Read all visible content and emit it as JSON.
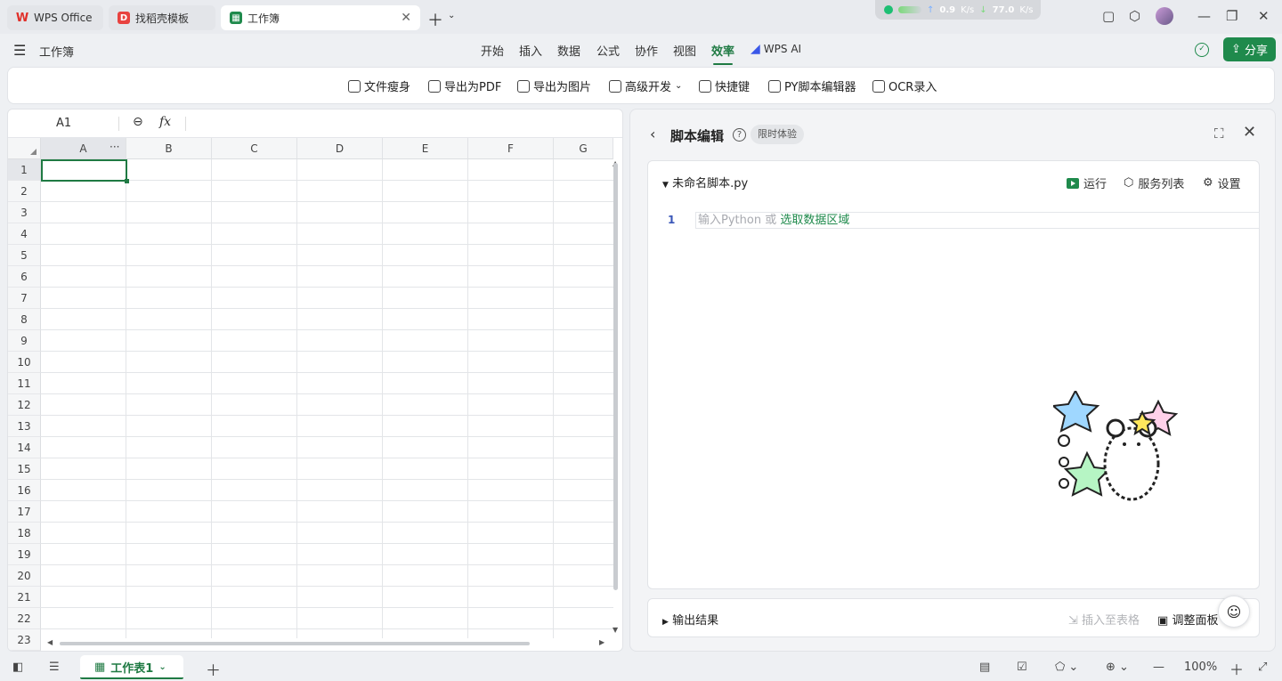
{
  "tabs": [
    {
      "label": "WPS Office"
    },
    {
      "label": "找稻壳模板"
    },
    {
      "label": "工作簿"
    }
  ],
  "netmon": {
    "up": "0.9",
    "up_unit": "K/s",
    "down": "77.0",
    "down_unit": "K/s"
  },
  "doc_title": "工作簿",
  "menu": [
    "开始",
    "插入",
    "数据",
    "公式",
    "协作",
    "视图",
    "效率"
  ],
  "menu_active_index": 6,
  "wps_ai_label": "WPS AI",
  "share_label": "分享",
  "toolbar": [
    "文件瘦身",
    "导出为PDF",
    "导出为图片",
    "高级开发",
    "快捷键",
    "PY脚本编辑器",
    "OCR录入"
  ],
  "formula_bar": {
    "cell_ref": "A1",
    "fx": "fx",
    "value": ""
  },
  "columns": [
    "A",
    "B",
    "C",
    "D",
    "E",
    "F",
    "G"
  ],
  "rows": [
    "1",
    "2",
    "3",
    "4",
    "5",
    "6",
    "7",
    "8",
    "9",
    "10",
    "11",
    "12",
    "13",
    "14",
    "15",
    "16",
    "17",
    "18",
    "19",
    "20",
    "21",
    "22",
    "23"
  ],
  "active_cell": "A1",
  "panel": {
    "title": "脚本编辑",
    "badge": "限时体验",
    "file_name": "未命名脚本.py",
    "run_label": "运行",
    "services_label": "服务列表",
    "settings_label": "设置",
    "line_number": "1",
    "placeholder_prefix": "输入Python 或 ",
    "placeholder_link": "选取数据区域",
    "output_label": "输出结果",
    "insert_label": "插入至表格",
    "adjust_label": "调整面板"
  },
  "statusbar": {
    "sheet_name": "工作表1",
    "zoom": "100%"
  },
  "colors": {
    "accent": "#1f7a43",
    "brand_red": "#e0302a",
    "ai_blue": "#3a57e8"
  }
}
